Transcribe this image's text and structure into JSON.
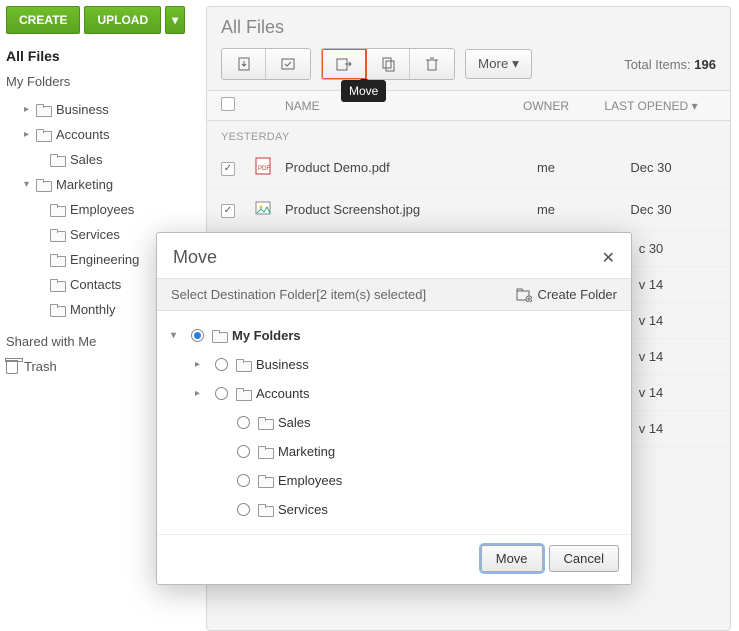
{
  "sidebar": {
    "create": "CREATE",
    "upload": "UPLOAD",
    "root": "All Files",
    "section1": "My Folders",
    "items": [
      {
        "label": "Business"
      },
      {
        "label": "Accounts"
      },
      {
        "label": "Sales"
      },
      {
        "label": "Marketing"
      },
      {
        "label": "Employees"
      },
      {
        "label": "Services"
      },
      {
        "label": "Engineering"
      },
      {
        "label": "Contacts"
      },
      {
        "label": "Monthly"
      }
    ],
    "shared": "Shared with Me",
    "trash": "Trash"
  },
  "main": {
    "title": "All Files",
    "more": "More",
    "total_label": "Total Items:",
    "total_count": "196",
    "tooltip": "Move",
    "cols": {
      "name": "NAME",
      "owner": "OWNER",
      "date": "LAST OPENED"
    },
    "group": "YESTERDAY",
    "rows": [
      {
        "name": "Product Demo.pdf",
        "owner": "me",
        "date": "Dec 30"
      },
      {
        "name": "Product Screenshot.jpg",
        "owner": "me",
        "date": "Dec 30"
      }
    ],
    "obscured_dates": [
      "c 30",
      "v 14",
      "v 14",
      "v 14",
      "v 14",
      "v 14"
    ]
  },
  "modal": {
    "title": "Move",
    "subtitle": "Select Destination Folder[2 item(s) selected]",
    "create_folder": "Create Folder",
    "tree": [
      {
        "label": "My Folders",
        "level": 0,
        "expand": "down",
        "selected": true
      },
      {
        "label": "Business",
        "level": 1,
        "expand": "right"
      },
      {
        "label": "Accounts",
        "level": 1,
        "expand": "right"
      },
      {
        "label": "Sales",
        "level": 2
      },
      {
        "label": "Marketing",
        "level": 2
      },
      {
        "label": "Employees",
        "level": 2
      },
      {
        "label": "Services",
        "level": 2
      }
    ],
    "ok": "Move",
    "cancel": "Cancel"
  }
}
